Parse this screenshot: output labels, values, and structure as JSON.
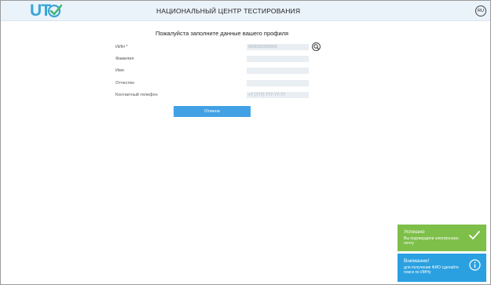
{
  "header": {
    "logo_text": "UT",
    "title": "НАЦИОНАЛЬНЫЙ ЦЕНТР ТЕСТИРОВАНИЯ",
    "language": "RU"
  },
  "form": {
    "title": "Пожалуйста заполните данные вашего профиля",
    "fields": [
      {
        "label": "ИИН *",
        "value": "",
        "placeholder": "000000000000"
      },
      {
        "label": "Фамилия",
        "value": "",
        "placeholder": ""
      },
      {
        "label": "Имя",
        "value": "",
        "placeholder": ""
      },
      {
        "label": "Отчество",
        "value": "",
        "placeholder": ""
      },
      {
        "label": "Контактный телефон",
        "value": "",
        "placeholder": "+7 (777) 777-77-77"
      }
    ],
    "submit_label": "Отмена"
  },
  "toasts": [
    {
      "title": "Успешно",
      "text": "Вы подтвердили электронную почту",
      "color": "#7dbf48",
      "icon": "checkmark-icon"
    },
    {
      "title": "Внимание!",
      "text": "для получения ФИО сделайте поиск по ИИНу",
      "color": "#2aa0e0",
      "icon": "info-icon"
    }
  ],
  "colors": {
    "accent": "#42a1e4",
    "header_bg": "#eaf2fa",
    "input_bg": "#e9eef3"
  }
}
